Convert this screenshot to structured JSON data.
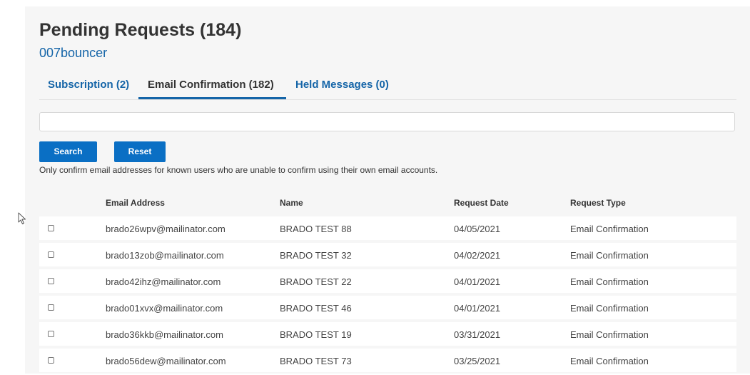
{
  "header": {
    "title": "Pending Requests (184)",
    "list_name": "007bouncer"
  },
  "tabs": [
    {
      "label": "Subscription (2)",
      "active": false
    },
    {
      "label": "Email Confirmation (182)",
      "active": true
    },
    {
      "label": "Held Messages (0)",
      "active": false
    }
  ],
  "search": {
    "value": "",
    "placeholder": "",
    "search_label": "Search",
    "reset_label": "Reset"
  },
  "note": "Only confirm email addresses for known users who are unable to confirm using their own email accounts.",
  "table": {
    "columns": [
      "Email Address",
      "Name",
      "Request Date",
      "Request Type"
    ],
    "rows": [
      {
        "email": "brado26wpv@mailinator.com",
        "name": "BRADO TEST 88",
        "date": "04/05/2021",
        "type": "Email Confirmation"
      },
      {
        "email": "brado13zob@mailinator.com",
        "name": "BRADO TEST 32",
        "date": "04/02/2021",
        "type": "Email Confirmation"
      },
      {
        "email": "brado42ihz@mailinator.com",
        "name": "BRADO TEST 22",
        "date": "04/01/2021",
        "type": "Email Confirmation"
      },
      {
        "email": "brado01xvx@mailinator.com",
        "name": "BRADO TEST 46",
        "date": "04/01/2021",
        "type": "Email Confirmation"
      },
      {
        "email": "brado36kkb@mailinator.com",
        "name": "BRADO TEST 19",
        "date": "03/31/2021",
        "type": "Email Confirmation"
      },
      {
        "email": "brado56dew@mailinator.com",
        "name": "BRADO TEST 73",
        "date": "03/25/2021",
        "type": "Email Confirmation"
      }
    ]
  },
  "colors": {
    "accent": "#1565a8",
    "button": "#0a6fc4",
    "panel_bg": "#f6f6f6"
  },
  "icons": {
    "cursor": "mouse-pointer-icon",
    "checkbox": "checkbox-icon"
  }
}
